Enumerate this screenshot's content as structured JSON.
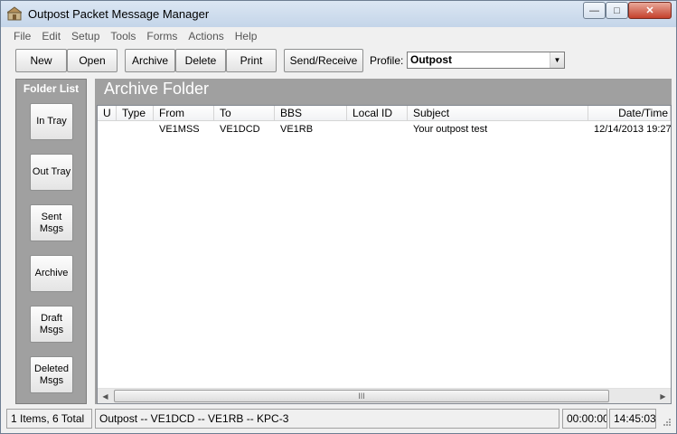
{
  "window": {
    "title": "Outpost Packet Message Manager",
    "minimize_glyph": "—",
    "maximize_glyph": "□",
    "close_glyph": "✕"
  },
  "menu": [
    "File",
    "Edit",
    "Setup",
    "Tools",
    "Forms",
    "Actions",
    "Help"
  ],
  "toolbar": {
    "new": "New",
    "open": "Open",
    "archive": "Archive",
    "delete": "Delete",
    "print": "Print",
    "send_receive": "Send/Receive",
    "profile_label": "Profile:",
    "profile_value": "Outpost"
  },
  "folders": {
    "title": "Folder List",
    "items": [
      {
        "line1": "In Tray",
        "line2": ""
      },
      {
        "line1": "Out Tray",
        "line2": ""
      },
      {
        "line1": "Sent",
        "line2": "Msgs"
      },
      {
        "line1": "Archive",
        "line2": ""
      },
      {
        "line1": "Draft",
        "line2": "Msgs"
      },
      {
        "line1": "Deleted",
        "line2": "Msgs"
      }
    ]
  },
  "main": {
    "header": "Archive Folder",
    "columns": [
      "U",
      "Type",
      "From",
      "To",
      "BBS",
      "Local ID",
      "Subject",
      "Date/Time"
    ],
    "rows": [
      {
        "u": "",
        "type": "",
        "from": "VE1MSS",
        "to": "VE1DCD",
        "bbs": "VE1RB",
        "local_id": "",
        "subject": "Your outpost test",
        "datetime": "12/14/2013 19:27"
      }
    ],
    "scroll_grip": "III"
  },
  "status": {
    "count": "1 Items, 6 Total",
    "connection": "Outpost -- VE1DCD -- VE1RB -- KPC-3",
    "timer": "00:00:00",
    "clock": "14:45:03"
  },
  "colors": {
    "panel_gray": "#a0a0a0",
    "titlebar": "#c4d5e9",
    "close_red": "#c4402b"
  }
}
